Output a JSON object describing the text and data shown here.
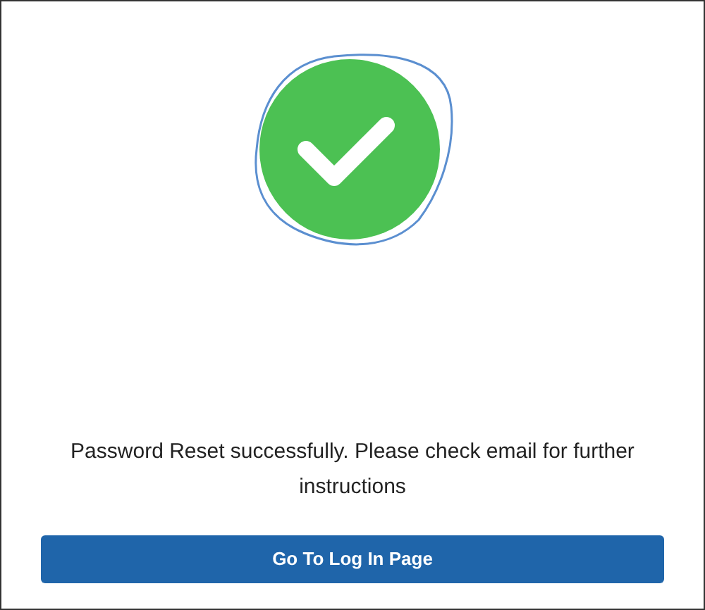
{
  "message": "Password Reset successfully. Please check email for further instructions",
  "button": {
    "label": "Go To Log In Page"
  }
}
